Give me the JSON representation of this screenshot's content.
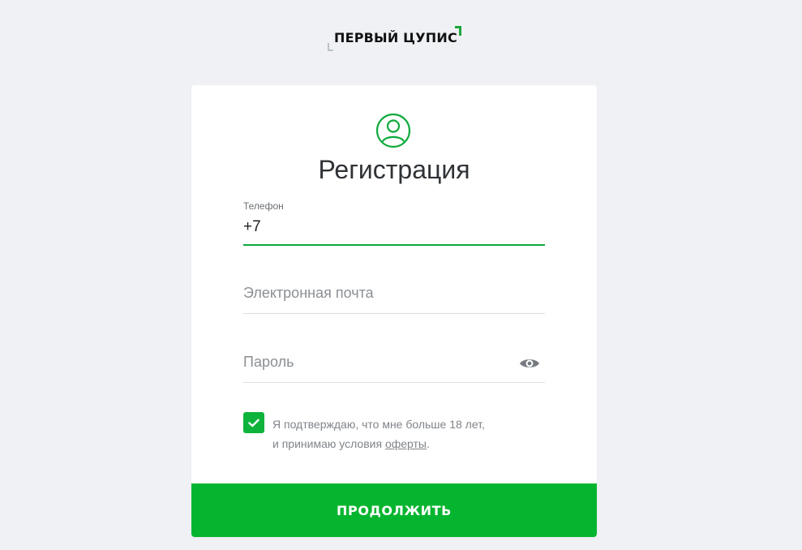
{
  "brand": {
    "name": "ПЕРВЫЙ ЦУПИС"
  },
  "form": {
    "title": "Регистрация",
    "phone": {
      "label": "Телефон",
      "value": "+7"
    },
    "email": {
      "placeholder": "Электронная почта"
    },
    "password": {
      "placeholder": "Пароль"
    },
    "consent": {
      "checked": true,
      "line1": "Я подтверждаю, что мне больше 18 лет,",
      "line2_prefix": "и принимаю условия ",
      "link_text": "оферты",
      "line2_suffix": "."
    },
    "submit_label": "ПРОДОЛЖИТЬ"
  },
  "icons": {
    "avatar": "user-circle-icon",
    "password_toggle": "eye-icon",
    "checkbox": "checkmark-icon"
  },
  "colors": {
    "accent": "#06b52f",
    "background": "#f0f1f5",
    "card": "#ffffff"
  }
}
